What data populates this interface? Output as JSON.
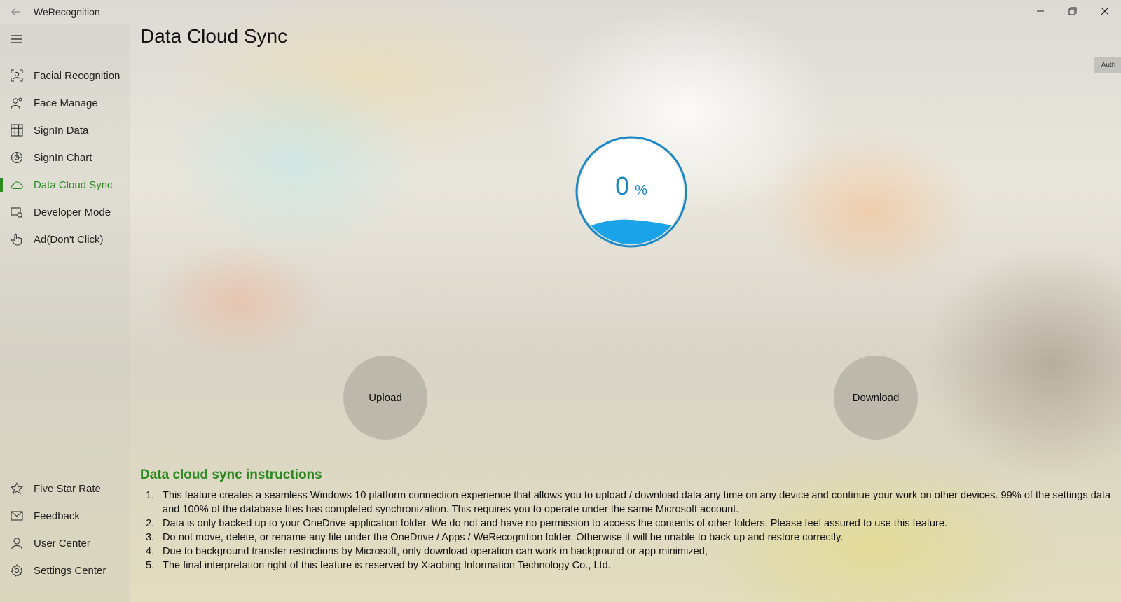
{
  "window": {
    "title": "WeRecognition",
    "controls": [
      "minimize",
      "restore",
      "close"
    ]
  },
  "sidebar": {
    "items": [
      {
        "label": "Facial Recognition",
        "icon": "face-scan-icon"
      },
      {
        "label": "Face Manage",
        "icon": "person-manage-icon"
      },
      {
        "label": "SignIn Data",
        "icon": "grid-table-icon"
      },
      {
        "label": "SignIn Chart",
        "icon": "pie-chart-icon"
      },
      {
        "label": "Data Cloud Sync",
        "icon": "cloud-icon",
        "active": true
      },
      {
        "label": "Developer Mode",
        "icon": "developer-icon"
      },
      {
        "label": "Ad(Don't Click)",
        "icon": "hand-pointer-icon"
      }
    ],
    "footer_items": [
      {
        "label": "Five Star Rate",
        "icon": "star-icon"
      },
      {
        "label": "Feedback",
        "icon": "mail-icon"
      },
      {
        "label": "User Center",
        "icon": "user-icon"
      },
      {
        "label": "Settings Center",
        "icon": "gear-icon"
      }
    ]
  },
  "main": {
    "title": "Data Cloud Sync",
    "auth_label": "Auth",
    "progress": {
      "value": "0",
      "unit": "%"
    },
    "upload_label": "Upload",
    "download_label": "Download",
    "instructions_title": "Data cloud sync instructions",
    "instructions": [
      {
        "num": "1.",
        "text": "This feature creates a seamless Windows 10 platform connection experience that allows you to upload / download data any time on any device and continue your work on other devices. 99% of the settings data and 100% of the database files has completed synchronization. This requires you to operate under the same Microsoft account."
      },
      {
        "num": "2.",
        "text": "Data is only backed up to your OneDrive application folder. We do not and have no permission to access the contents of other folders. Please feel assured to use this feature."
      },
      {
        "num": "3.",
        "text": "Do not move, delete, or rename any file under the OneDrive / Apps / WeRecognition folder. Otherwise it will be unable to back up and restore correctly."
      },
      {
        "num": "4.",
        "text": "Due to background transfer restrictions by Microsoft, only download operation can work in background or app minimized,"
      },
      {
        "num": "5.",
        "text": "The final interpretation right of this feature is reserved by Xiaobing Information Technology Co., Ltd."
      }
    ]
  },
  "colors": {
    "accent": "#2a8a1f",
    "progress": "#1a88c8",
    "water": "#1aa3e8"
  }
}
